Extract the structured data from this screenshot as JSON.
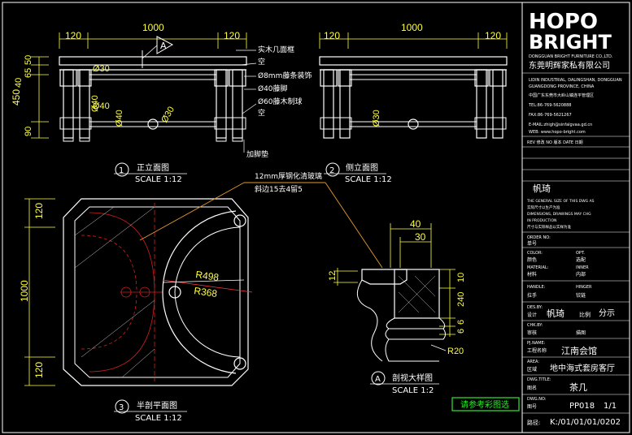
{
  "brand": {
    "logo_line1": "HOPO",
    "logo_line2": "BRIGHT",
    "company_en": "DONGGUAN BRIGHT FURNITURE CO.,LTD.",
    "company_cn": "东莞明辉家私有限公司",
    "address1": "LIDIN INDUSTRIAL, DALINGSHAN, DONGGUAN",
    "address2": "GUANGDONG PROVINCE, CHINA",
    "address_cn": "中国广东东莞市大岭山镇连平管理区",
    "tel": "TEL:86-769-5620888",
    "fax": "FAX:86-769-5621267",
    "email": "E-MAIL:zhigh@sinfalgvaa.gd.cn",
    "web": "WEB: www.hopo-bright.com"
  },
  "front_view": {
    "dims_top": [
      "120",
      "1000",
      "120"
    ],
    "dims_left": [
      "50",
      "65",
      "40",
      "450",
      "90"
    ],
    "dia_labels": [
      "Ø30",
      "Ø40",
      "Ø40",
      "Ø40",
      "Ø30"
    ],
    "section_marker": "A",
    "callouts": [
      "实木几面框",
      "空",
      "Ø8mm藤条装饰",
      "Ø40藤脚",
      "Ø60藤木制球",
      "空",
      "加脚垫"
    ],
    "title_num": "1",
    "title": "正立面图",
    "scale": "SCALE 1:12"
  },
  "side_view": {
    "dims_top": [
      "120",
      "1000",
      "120"
    ],
    "dia_label": "Ø30",
    "title_num": "2",
    "title": "侧立面图",
    "scale": "SCALE 1:12"
  },
  "plan_view": {
    "dims_left": [
      "120",
      "1000",
      "120"
    ],
    "glass_note1": "12mm厚钢化清玻璃",
    "glass_note2": "斜边15去4留5",
    "r1": "R498",
    "r2": "R368",
    "title_num": "3",
    "title": "半剖平面图",
    "scale": "SCALE 1:12"
  },
  "detail_view": {
    "dims_top": [
      "40",
      "30"
    ],
    "dims_left": [
      "12"
    ],
    "dims_right": [
      "10",
      "240",
      "6",
      "6"
    ],
    "radius": "R20",
    "title_num": "A",
    "title": "剖视大样图",
    "scale": "SCALE 1:2"
  },
  "title_block": {
    "rev_row": "REV 修改    NO 版本    DATE 日期",
    "client_name": "帆琦",
    "notes": [
      "THE GENERAL SIZE OF THIS DWG AS",
      "实际尺寸以生产为准",
      "DIMENSIONS, DRAWINGS MAY CHG",
      "IN PRODUCTION",
      "尺寸与实际样品以实样为准"
    ],
    "order_no_label": "ORDER NO:",
    "order_no_cn": "单号",
    "color_label": "COLOR:",
    "color_value": "OPT.",
    "color_cn": "颜色",
    "color_cn_value": "选配",
    "material_label": "MATERIAL:",
    "material_value": "INNER",
    "material_cn": "材料",
    "material_cn_value": "内部",
    "handle_label": "HANDLE:",
    "handle_value": "HINGER",
    "handle_cn": "拉手",
    "handle_cn_value": "铰链",
    "des_label": "DES.BY:",
    "des_cn": "设计",
    "des_value": "帆琦",
    "des_mid": "比例",
    "des_right": "分示",
    "chk_label": "CHK.BY:",
    "chk_cn": "审核",
    "chk_value": "描图",
    "prj_label": "PJ.NAME:",
    "prj_cn": "工程名称",
    "prj_value": "江南会馆",
    "area_label": "AREA:",
    "area_cn": "区域",
    "area_value": "地中海式套房客厅",
    "dwg_title_label": "DWG.TITLE:",
    "dwg_title_cn": "图名",
    "dwg_title_value": "茶几",
    "dwg_no_label": "DWG.NO:",
    "dwg_no_cn": "图号",
    "dwg_no_value": "PP018",
    "sheet": "1/1",
    "path_label": "路径:",
    "path_value": "K:/01/01/01/0202"
  },
  "reference_button": "请参考彩图选"
}
